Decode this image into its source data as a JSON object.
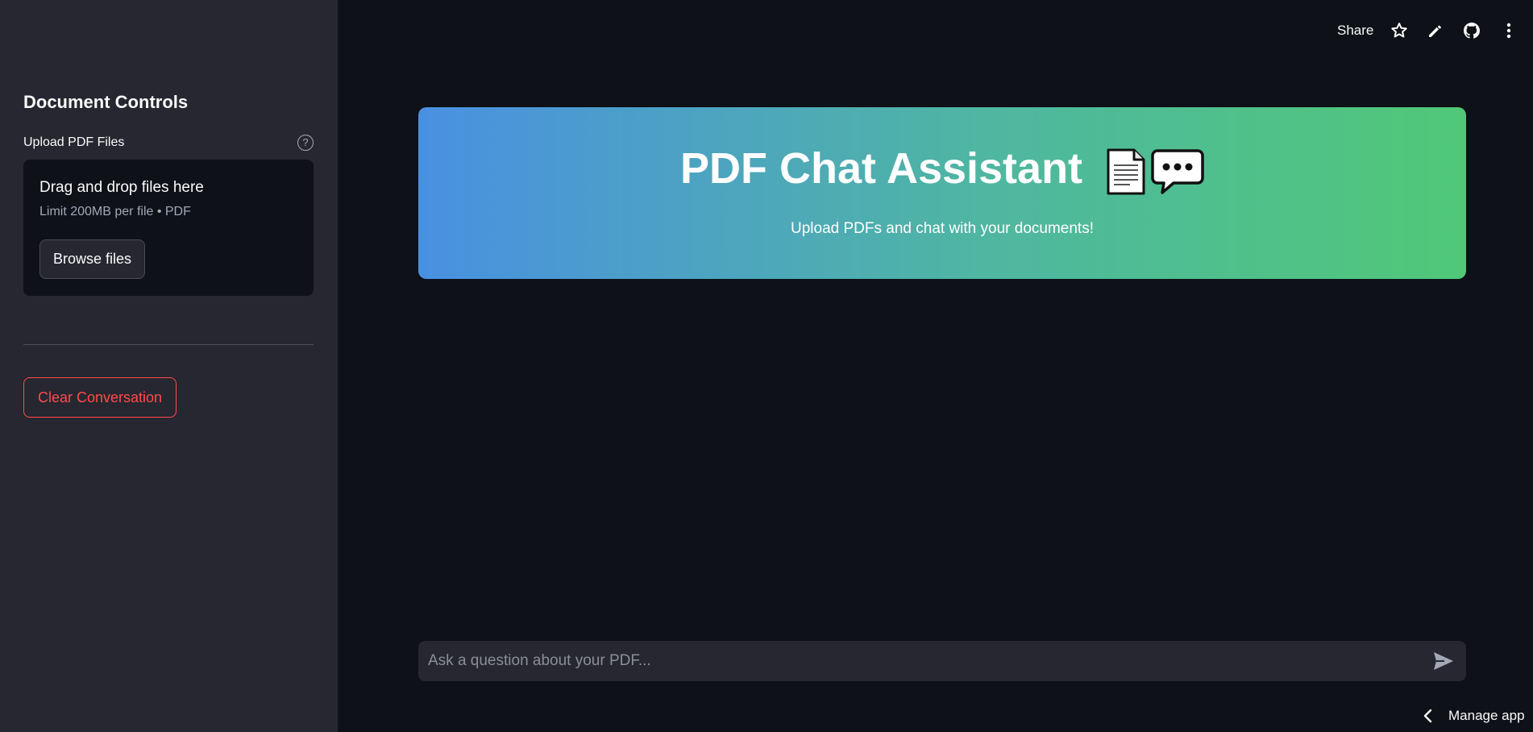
{
  "sidebar": {
    "title": "Document Controls",
    "uploader": {
      "label": "Upload PDF Files",
      "help_icon": "question-circle-icon",
      "drop_text": "Drag and drop files here",
      "limit_text": "Limit 200MB per file • PDF",
      "browse_label": "Browse files"
    },
    "clear_label": "Clear Conversation"
  },
  "toolbar": {
    "share_label": "Share",
    "icons": [
      "star-icon",
      "pencil-icon",
      "github-icon",
      "more-vertical-icon"
    ]
  },
  "hero": {
    "title": "PDF Chat Assistant",
    "emojis": [
      "document-icon",
      "speech-balloon-icon"
    ],
    "subtitle": "Upload PDFs and chat with your documents!",
    "gradient_start": "#4a90e2",
    "gradient_end": "#50c878"
  },
  "chat": {
    "placeholder": "Ask a question about your PDF...",
    "send_icon": "send-icon"
  },
  "footer": {
    "manage_label": "Manage app"
  },
  "colors": {
    "background": "#0e1117",
    "sidebar": "#262730",
    "danger": "#ff4b4b",
    "text": "#fafafa",
    "muted": "#a3a8b8"
  }
}
